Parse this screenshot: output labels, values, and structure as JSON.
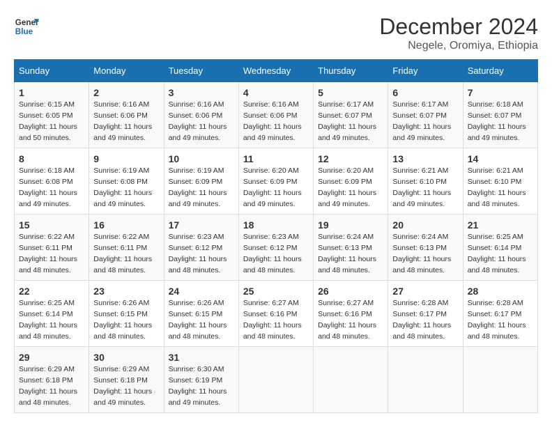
{
  "header": {
    "logo_line1": "General",
    "logo_line2": "Blue",
    "title": "December 2024",
    "subtitle": "Negele, Oromiya, Ethiopia"
  },
  "weekdays": [
    "Sunday",
    "Monday",
    "Tuesday",
    "Wednesday",
    "Thursday",
    "Friday",
    "Saturday"
  ],
  "weeks": [
    [
      {
        "day": "1",
        "info": "Sunrise: 6:15 AM\nSunset: 6:05 PM\nDaylight: 11 hours\nand 50 minutes."
      },
      {
        "day": "2",
        "info": "Sunrise: 6:16 AM\nSunset: 6:06 PM\nDaylight: 11 hours\nand 49 minutes."
      },
      {
        "day": "3",
        "info": "Sunrise: 6:16 AM\nSunset: 6:06 PM\nDaylight: 11 hours\nand 49 minutes."
      },
      {
        "day": "4",
        "info": "Sunrise: 6:16 AM\nSunset: 6:06 PM\nDaylight: 11 hours\nand 49 minutes."
      },
      {
        "day": "5",
        "info": "Sunrise: 6:17 AM\nSunset: 6:07 PM\nDaylight: 11 hours\nand 49 minutes."
      },
      {
        "day": "6",
        "info": "Sunrise: 6:17 AM\nSunset: 6:07 PM\nDaylight: 11 hours\nand 49 minutes."
      },
      {
        "day": "7",
        "info": "Sunrise: 6:18 AM\nSunset: 6:07 PM\nDaylight: 11 hours\nand 49 minutes."
      }
    ],
    [
      {
        "day": "8",
        "info": "Sunrise: 6:18 AM\nSunset: 6:08 PM\nDaylight: 11 hours\nand 49 minutes."
      },
      {
        "day": "9",
        "info": "Sunrise: 6:19 AM\nSunset: 6:08 PM\nDaylight: 11 hours\nand 49 minutes."
      },
      {
        "day": "10",
        "info": "Sunrise: 6:19 AM\nSunset: 6:09 PM\nDaylight: 11 hours\nand 49 minutes."
      },
      {
        "day": "11",
        "info": "Sunrise: 6:20 AM\nSunset: 6:09 PM\nDaylight: 11 hours\nand 49 minutes."
      },
      {
        "day": "12",
        "info": "Sunrise: 6:20 AM\nSunset: 6:09 PM\nDaylight: 11 hours\nand 49 minutes."
      },
      {
        "day": "13",
        "info": "Sunrise: 6:21 AM\nSunset: 6:10 PM\nDaylight: 11 hours\nand 49 minutes."
      },
      {
        "day": "14",
        "info": "Sunrise: 6:21 AM\nSunset: 6:10 PM\nDaylight: 11 hours\nand 48 minutes."
      }
    ],
    [
      {
        "day": "15",
        "info": "Sunrise: 6:22 AM\nSunset: 6:11 PM\nDaylight: 11 hours\nand 48 minutes."
      },
      {
        "day": "16",
        "info": "Sunrise: 6:22 AM\nSunset: 6:11 PM\nDaylight: 11 hours\nand 48 minutes."
      },
      {
        "day": "17",
        "info": "Sunrise: 6:23 AM\nSunset: 6:12 PM\nDaylight: 11 hours\nand 48 minutes."
      },
      {
        "day": "18",
        "info": "Sunrise: 6:23 AM\nSunset: 6:12 PM\nDaylight: 11 hours\nand 48 minutes."
      },
      {
        "day": "19",
        "info": "Sunrise: 6:24 AM\nSunset: 6:13 PM\nDaylight: 11 hours\nand 48 minutes."
      },
      {
        "day": "20",
        "info": "Sunrise: 6:24 AM\nSunset: 6:13 PM\nDaylight: 11 hours\nand 48 minutes."
      },
      {
        "day": "21",
        "info": "Sunrise: 6:25 AM\nSunset: 6:14 PM\nDaylight: 11 hours\nand 48 minutes."
      }
    ],
    [
      {
        "day": "22",
        "info": "Sunrise: 6:25 AM\nSunset: 6:14 PM\nDaylight: 11 hours\nand 48 minutes."
      },
      {
        "day": "23",
        "info": "Sunrise: 6:26 AM\nSunset: 6:15 PM\nDaylight: 11 hours\nand 48 minutes."
      },
      {
        "day": "24",
        "info": "Sunrise: 6:26 AM\nSunset: 6:15 PM\nDaylight: 11 hours\nand 48 minutes."
      },
      {
        "day": "25",
        "info": "Sunrise: 6:27 AM\nSunset: 6:16 PM\nDaylight: 11 hours\nand 48 minutes."
      },
      {
        "day": "26",
        "info": "Sunrise: 6:27 AM\nSunset: 6:16 PM\nDaylight: 11 hours\nand 48 minutes."
      },
      {
        "day": "27",
        "info": "Sunrise: 6:28 AM\nSunset: 6:17 PM\nDaylight: 11 hours\nand 48 minutes."
      },
      {
        "day": "28",
        "info": "Sunrise: 6:28 AM\nSunset: 6:17 PM\nDaylight: 11 hours\nand 48 minutes."
      }
    ],
    [
      {
        "day": "29",
        "info": "Sunrise: 6:29 AM\nSunset: 6:18 PM\nDaylight: 11 hours\nand 48 minutes."
      },
      {
        "day": "30",
        "info": "Sunrise: 6:29 AM\nSunset: 6:18 PM\nDaylight: 11 hours\nand 49 minutes."
      },
      {
        "day": "31",
        "info": "Sunrise: 6:30 AM\nSunset: 6:19 PM\nDaylight: 11 hours\nand 49 minutes."
      },
      null,
      null,
      null,
      null
    ]
  ]
}
